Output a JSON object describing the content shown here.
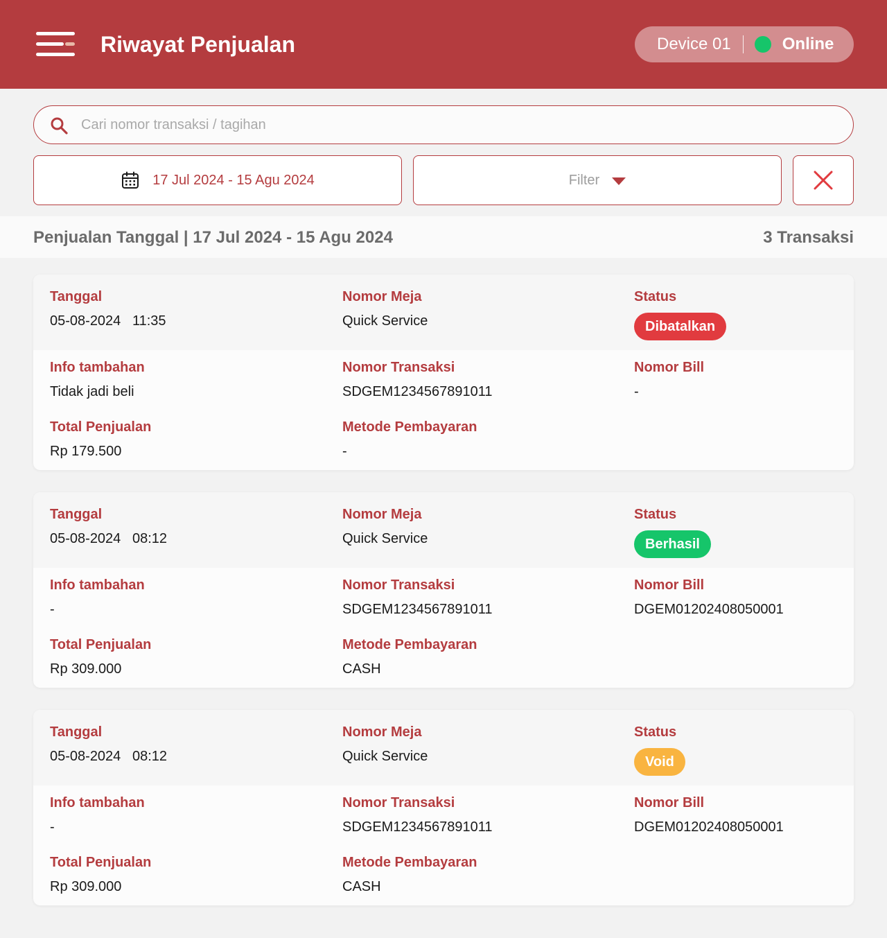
{
  "header": {
    "title": "Riwayat Penjualan",
    "device": "Device 01",
    "connection_status": "Online",
    "connection_color": "#16c56a"
  },
  "search": {
    "placeholder": "Cari nomor transaksi / tagihan",
    "value": ""
  },
  "filters": {
    "date_range": "17 Jul 2024 - 15 Agu 2024",
    "filter_label": "Filter"
  },
  "summary": {
    "label": "Penjualan Tanggal | 17 Jul 2024 - 15 Agu 2024",
    "count": "3 Transaksi"
  },
  "labels": {
    "date": "Tanggal",
    "table": "Nomor Meja",
    "status": "Status",
    "info": "Info tambahan",
    "trx_no": "Nomor Transaksi",
    "bill_no": "Nomor Bill",
    "total": "Total Penjualan",
    "payment": "Metode Pembayaran"
  },
  "transactions": [
    {
      "datetime": "05-08-2024   11:35",
      "table": "Quick Service",
      "status": "Dibatalkan",
      "status_color": "#e13b3f",
      "info": "Tidak jadi beli",
      "trx_no": "SDGEM1234567891011",
      "bill_no": "-",
      "total": "Rp 179.500",
      "payment": "-"
    },
    {
      "datetime": "05-08-2024   08:12",
      "table": "Quick Service",
      "status": "Berhasil",
      "status_color": "#16c56a",
      "info": "-",
      "trx_no": "SDGEM1234567891011",
      "bill_no": "DGEM01202408050001",
      "total": "Rp 309.000",
      "payment": "CASH"
    },
    {
      "datetime": "05-08-2024   08:12",
      "table": "Quick Service",
      "status": "Void",
      "status_color": "#f9b440",
      "info": "-",
      "trx_no": "SDGEM1234567891011",
      "bill_no": "DGEM01202408050001",
      "total": "Rp 309.000",
      "payment": "CASH"
    }
  ]
}
